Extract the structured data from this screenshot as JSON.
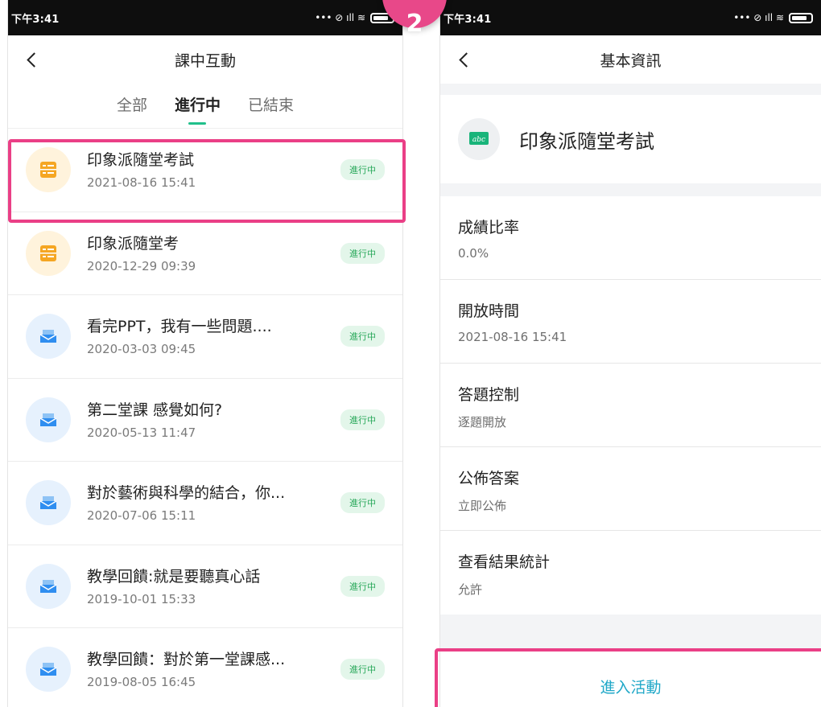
{
  "left_screen": {
    "status_time": "下午3:41",
    "status_icons": "... ⌛ .ıll ◎",
    "title": "課中互動",
    "tabs": [
      "全部",
      "進行中",
      "已結束"
    ],
    "items": [
      {
        "title": "印象派隨堂考試",
        "date": "2021-08-16 15:41",
        "status": "進行中",
        "icon": "quiz-icon"
      },
      {
        "title": "印象派隨堂考",
        "date": "2020-12-29 09:39",
        "status": "進行中",
        "icon": "quiz-icon"
      },
      {
        "title": "看完PPT，我有一些問題....",
        "date": "2020-03-03 09:45",
        "status": "進行中",
        "icon": "message-icon"
      },
      {
        "title": "第二堂課 感覺如何?",
        "date": "2020-05-13 11:47",
        "status": "進行中",
        "icon": "message-icon"
      },
      {
        "title": "對於藝術與科學的結合，你...",
        "date": "2020-07-06 15:11",
        "status": "進行中",
        "icon": "message-icon"
      },
      {
        "title": "教學回饋:就是要聽真心話",
        "date": "2019-10-01 15:33",
        "status": "進行中",
        "icon": "message-icon"
      },
      {
        "title": "教學回饋：對於第一堂課感...",
        "date": "2019-08-05 16:45",
        "status": "進行中",
        "icon": "message-icon"
      }
    ]
  },
  "step_badge": "2",
  "right_screen": {
    "status_time": "下午3:41",
    "title": "基本資訊",
    "activity_title": "印象派隨堂考試",
    "fields": [
      {
        "label": "成績比率",
        "value": "0.0%"
      },
      {
        "label": "開放時間",
        "value": "2021-08-16 15:41"
      },
      {
        "label": "答題控制",
        "value": "逐題開放"
      },
      {
        "label": "公佈答案",
        "value": "立即公佈"
      },
      {
        "label": "查看結果統計",
        "value": "允許"
      }
    ],
    "enter_button": "進入活動"
  },
  "colors": {
    "accent_green": "#21c08b",
    "highlight_pink": "#ea3f86",
    "badge_bg": "#e3f6ea",
    "badge_text": "#28a85a",
    "link_blue": "#21a8c8"
  }
}
